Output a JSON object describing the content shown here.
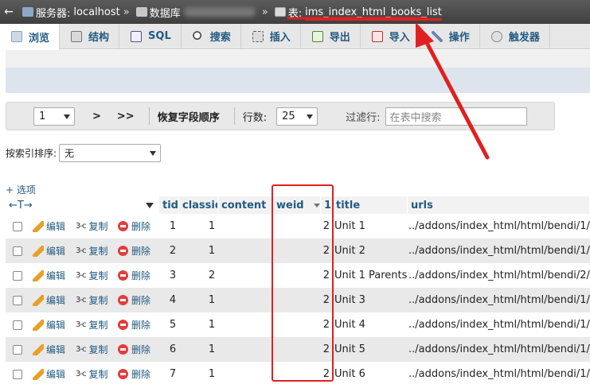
{
  "breadcrumb": {
    "back": "←",
    "server_label": "服务器:",
    "server": "localhost",
    "db_label": "数据库",
    "table_label": "表:",
    "table": "ims_index_html_books_list",
    "separator": "»"
  },
  "tabs": [
    {
      "label": "浏览",
      "icon": "browse-icon",
      "active": true
    },
    {
      "label": "结构",
      "icon": "structure-icon"
    },
    {
      "label": "SQL",
      "icon": "sql-icon"
    },
    {
      "label": "搜索",
      "icon": "search-icon"
    },
    {
      "label": "插入",
      "icon": "insert-icon"
    },
    {
      "label": "导出",
      "icon": "export-icon"
    },
    {
      "label": "导入",
      "icon": "import-icon"
    },
    {
      "label": "操作",
      "icon": "wrench-icon"
    },
    {
      "label": "触发器",
      "icon": "triggers-icon"
    }
  ],
  "navigation": {
    "page_value": "1",
    "next": ">",
    "last": ">>",
    "restore_order": "恢复字段顺序",
    "rows_label": "行数:",
    "rows_value": "25",
    "filter_label": "过滤行:",
    "filter_placeholder": "在表中搜索"
  },
  "sort": {
    "label": "按索引排序:",
    "value": "无"
  },
  "options_link": "+ 选项",
  "header_arrows": "←T→",
  "columns": [
    "tid",
    "classid",
    "content",
    "weid",
    "1",
    "title",
    "urls"
  ],
  "actions": {
    "edit": "编辑",
    "copy": "复制",
    "delete": "删除"
  },
  "rows": [
    {
      "tid": "1",
      "classid": "1",
      "content": "",
      "weid": "2",
      "title": "Unit 1",
      "urls": "../addons/index_html/html/bendi/1/"
    },
    {
      "tid": "2",
      "classid": "1",
      "content": "",
      "weid": "2",
      "title": "Unit 2",
      "urls": "../addons/index_html/html/bendi/1/"
    },
    {
      "tid": "3",
      "classid": "2",
      "content": "",
      "weid": "2",
      "title": "Unit 1 Parents",
      "urls": "../addons/index_html/html/bendi/2/"
    },
    {
      "tid": "4",
      "classid": "1",
      "content": "",
      "weid": "2",
      "title": "Unit 3",
      "urls": "../addons/index_html/html/bendi/1/"
    },
    {
      "tid": "5",
      "classid": "1",
      "content": "",
      "weid": "2",
      "title": "Unit 4",
      "urls": "../addons/index_html/html/bendi/1/"
    },
    {
      "tid": "6",
      "classid": "1",
      "content": "",
      "weid": "2",
      "title": "Unit 5",
      "urls": "../addons/index_html/html/bendi/1/"
    },
    {
      "tid": "7",
      "classid": "1",
      "content": "",
      "weid": "2",
      "title": "Unit 6",
      "urls": "../addons/index_html/html/bendi/1/"
    }
  ],
  "colors": {
    "link": "#235a81",
    "annotation": "#e02020"
  }
}
